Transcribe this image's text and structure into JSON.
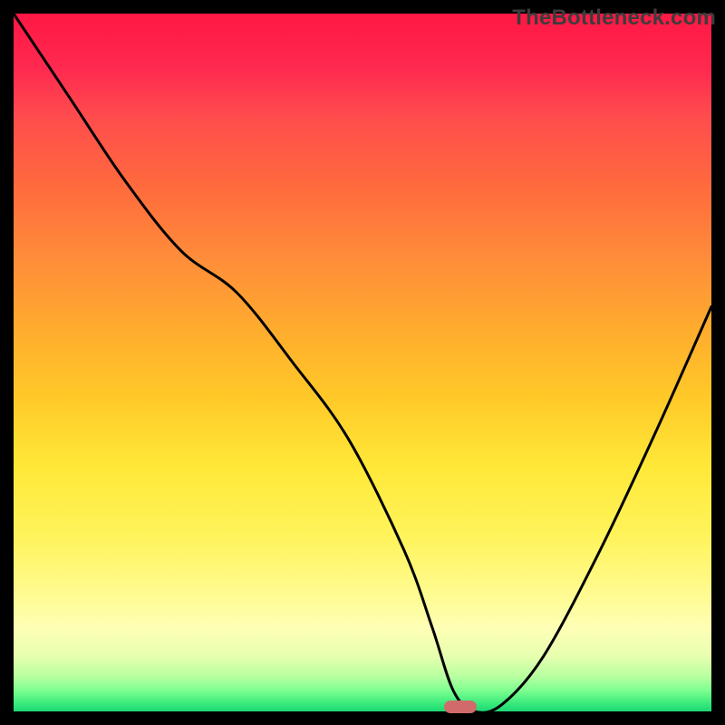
{
  "watermark": "TheBottleneck.com",
  "chart_data": {
    "type": "line",
    "title": "",
    "xlabel": "",
    "ylabel": "",
    "x_range": [
      0,
      100
    ],
    "y_range": [
      0,
      100
    ],
    "series": [
      {
        "name": "bottleneck-curve",
        "x": [
          0,
          8,
          16,
          24,
          32,
          40,
          48,
          56,
          60,
          63,
          66,
          70,
          76,
          84,
          92,
          100
        ],
        "values": [
          100,
          88,
          76,
          66,
          60,
          50,
          39,
          23,
          12,
          3,
          0,
          1,
          8,
          23,
          40,
          58
        ]
      }
    ],
    "optimal_marker_x": 64,
    "background_gradient": [
      "#ff1744",
      "#ffab2e",
      "#fff45c",
      "#1dd873"
    ]
  },
  "marker": {
    "label": "optimal-point"
  }
}
